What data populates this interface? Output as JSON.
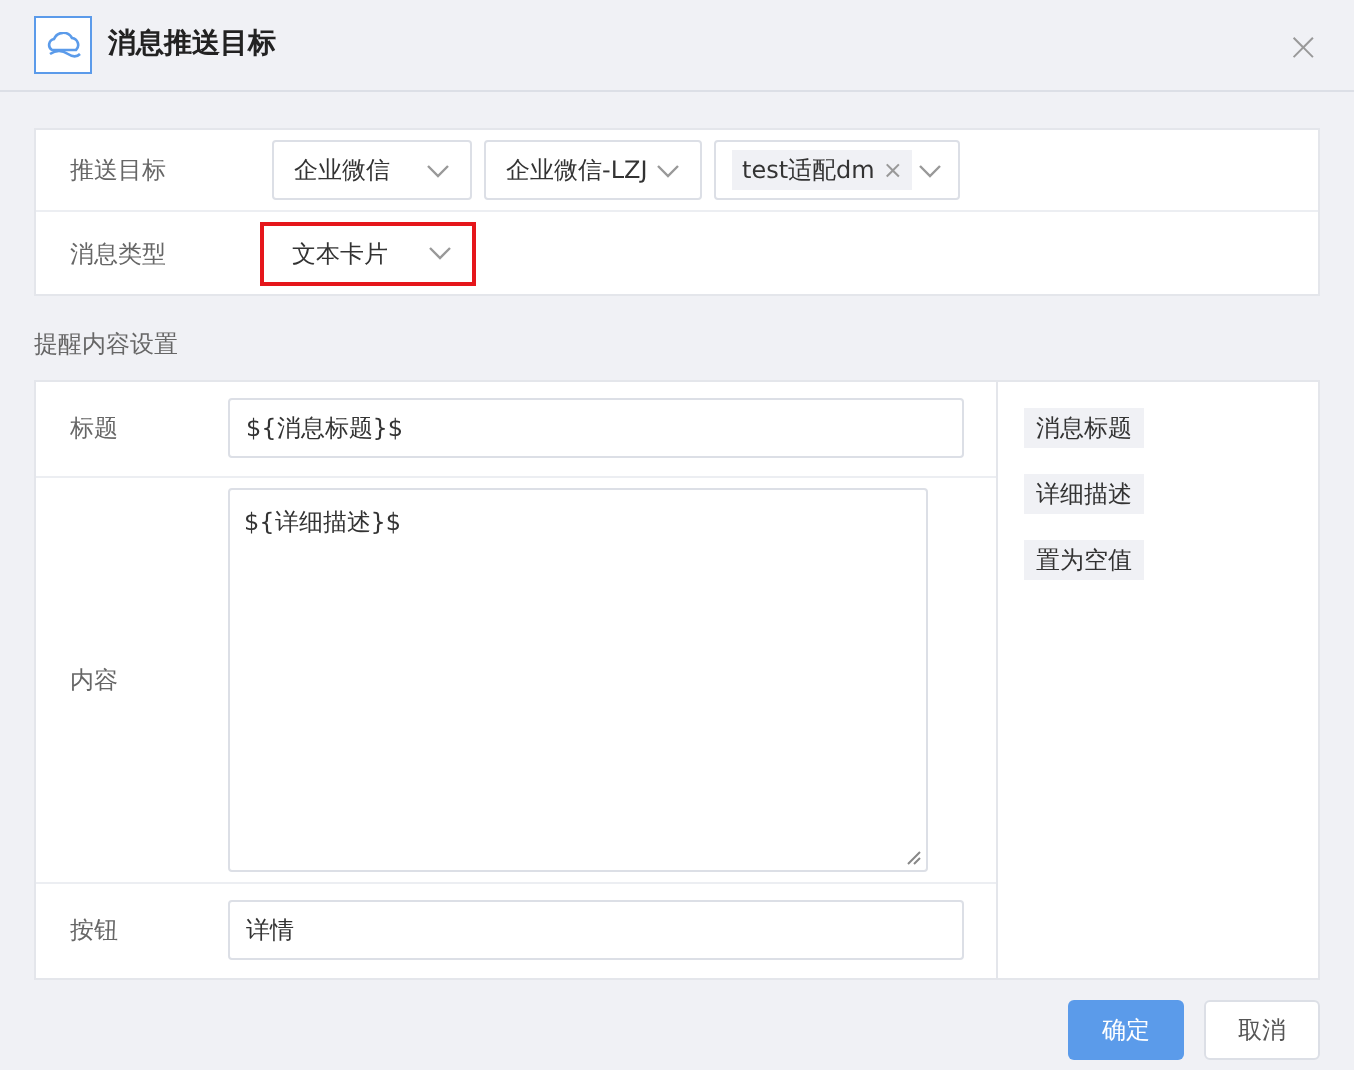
{
  "dialog": {
    "title": "消息推送目标",
    "close": "×"
  },
  "target": {
    "label": "推送目标",
    "selects": [
      {
        "kind": "select",
        "value": "企业微信"
      },
      {
        "kind": "select",
        "value": "企业微信-LZJ"
      },
      {
        "kind": "tags",
        "tags": [
          {
            "label": "test适配dm",
            "remove": "×"
          }
        ]
      }
    ]
  },
  "message_type": {
    "label": "消息类型",
    "value": "文本卡片",
    "highlighted": true
  },
  "section_title": "提醒内容设置",
  "fields": [
    {
      "kind": "input",
      "label": "标题",
      "value": "${消息标题}$"
    },
    {
      "kind": "textarea",
      "label": "内容",
      "value": "${详细描述}$"
    },
    {
      "kind": "input",
      "label": "按钮",
      "value": "详情"
    }
  ],
  "insert_buttons": [
    "消息标题",
    "详细描述",
    "置为空值"
  ],
  "buttons": [
    {
      "label": "确定",
      "primary": true
    },
    {
      "label": "取消",
      "primary": false
    }
  ]
}
